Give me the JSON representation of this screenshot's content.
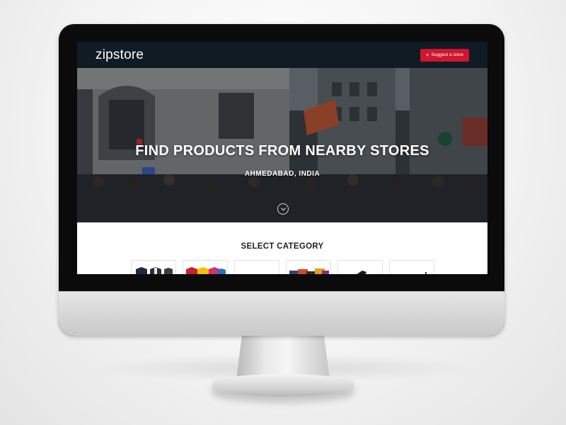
{
  "navbar": {
    "logo": "zipstore",
    "suggest_button": {
      "icon": "plus-icon",
      "label": "Suggest a store"
    }
  },
  "hero": {
    "title": "FIND PRODUCTS FROM NEARBY STORES",
    "location": "AHMEDABAD, INDIA",
    "scroll_icon": "chevron-down-icon"
  },
  "categories": {
    "heading": "SELECT CATEGORY",
    "items": [
      {
        "name": "menswear-thumbnail"
      },
      {
        "name": "tshirts-thumbnail"
      },
      {
        "name": "blank-thumbnail"
      },
      {
        "name": "bags-thumbnail"
      },
      {
        "name": "shoes-thumbnail"
      },
      {
        "name": "accessories-thumbnail"
      }
    ]
  },
  "colors": {
    "navbar": "#101b24",
    "accent": "#d0152f",
    "monitor_bezel": "#0b0b0b",
    "monitor_chin": "#d8d8d8"
  }
}
